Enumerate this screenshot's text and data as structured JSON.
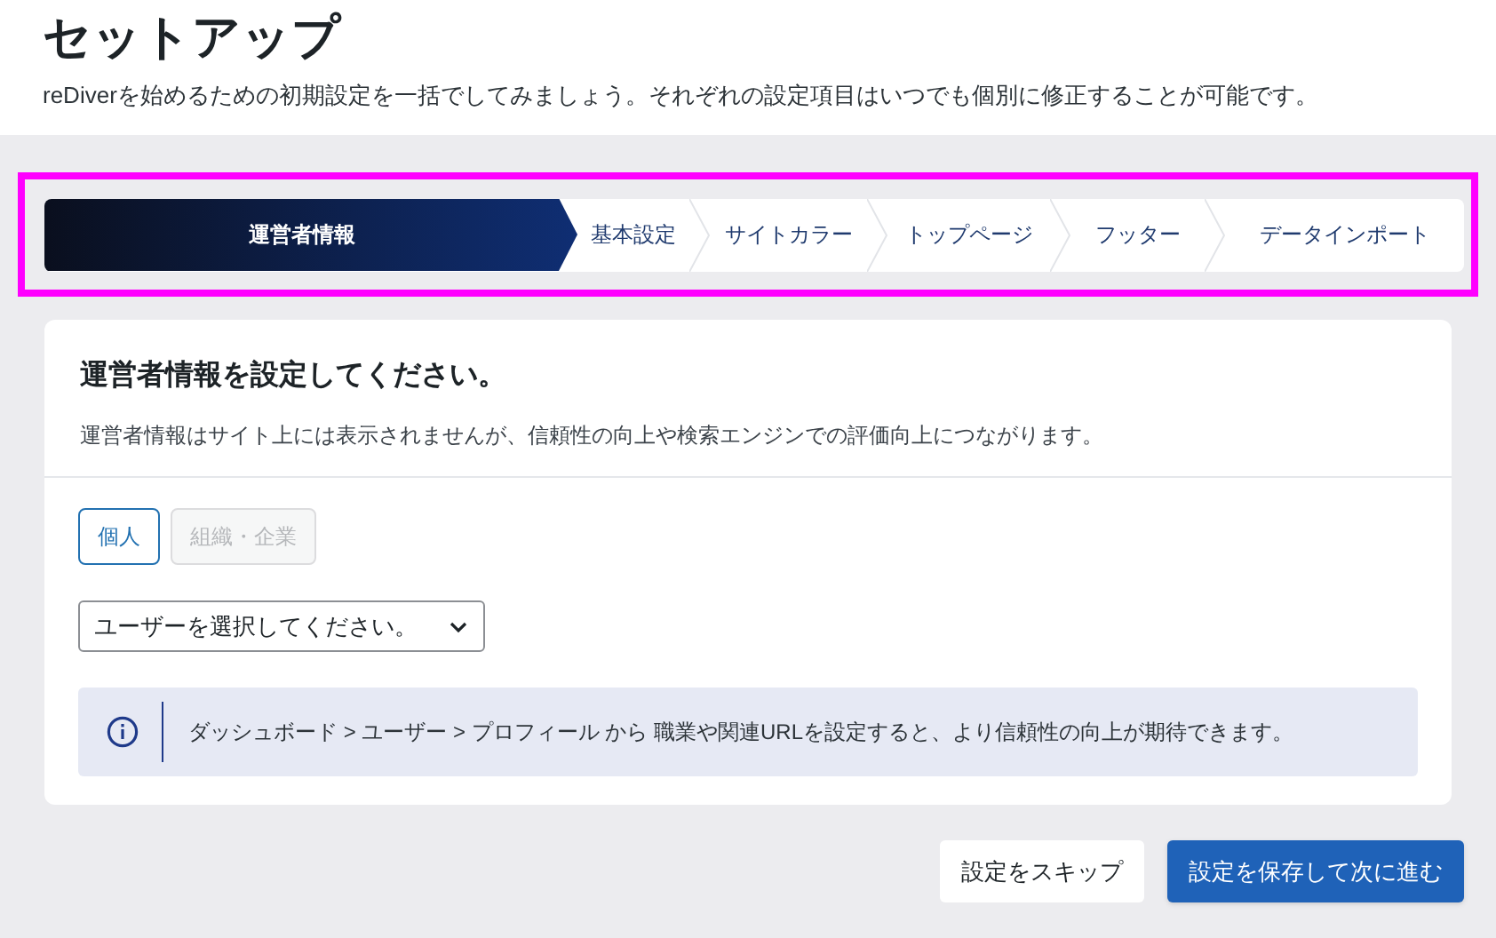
{
  "header": {
    "title": "セットアップ",
    "description": "reDiverを始めるための初期設定を一括でしてみましょう。それぞれの設定項目はいつでも個別に修正することが可能です。"
  },
  "steps": [
    {
      "label": "運営者情報",
      "selected": true
    },
    {
      "label": "基本設定",
      "selected": false
    },
    {
      "label": "サイトカラー",
      "selected": false
    },
    {
      "label": "トップページ",
      "selected": false
    },
    {
      "label": "フッター",
      "selected": false
    },
    {
      "label": "データインポート",
      "selected": false
    }
  ],
  "card": {
    "title": "運営者情報を設定してください。",
    "description": "運営者情報はサイト上には表示されませんが、信頼性の向上や検索エンジンでの評価向上につながります。",
    "types": [
      {
        "label": "個人",
        "selected": true
      },
      {
        "label": "組織・企業",
        "selected": false
      }
    ],
    "user_select": {
      "value": "ユーザーを選択してください。"
    },
    "notice": "ダッシュボード > ユーザー > プロフィール から 職業や関連URLを設定すると、より信頼性の向上が期待できます。"
  },
  "buttons": [
    {
      "label": "設定をスキップ",
      "kind": "secondary"
    },
    {
      "label": "設定を保存して次に進む",
      "kind": "primary"
    }
  ]
}
